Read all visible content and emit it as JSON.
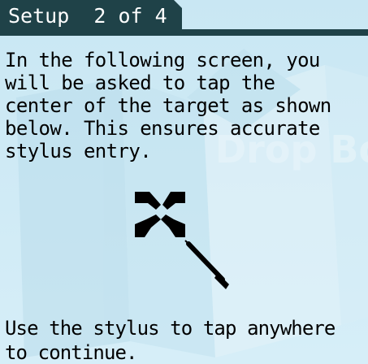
{
  "header": {
    "title": "Setup  2 of 4"
  },
  "instructions": {
    "text": "In the following screen, you\nwill be asked to tap the\ncenter of the target as shown\nbelow. This ensures accurate\nstylus entry."
  },
  "footer": {
    "text": "Use the stylus to tap anywhere\nto continue."
  },
  "watermark": {
    "text": "Drop Bo"
  },
  "icons": {
    "target": "target-crosshair-icon",
    "stylus": "stylus-icon"
  },
  "colors": {
    "background": "#d0ecf6",
    "title_bar": "#1f4248",
    "title_text": "#ffffff",
    "body_text": "#000000"
  }
}
